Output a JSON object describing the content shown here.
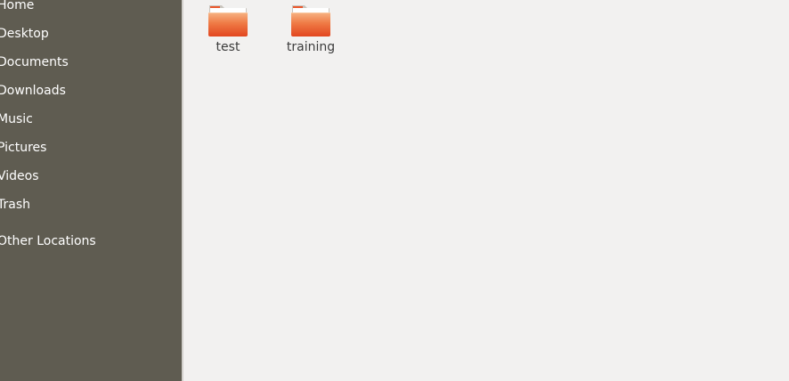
{
  "sidebar": {
    "items": [
      {
        "label": "Home",
        "icon": "home-icon"
      },
      {
        "label": "Desktop",
        "icon": "desktop-icon"
      },
      {
        "label": "Documents",
        "icon": "documents-icon"
      },
      {
        "label": "Downloads",
        "icon": "downloads-icon"
      },
      {
        "label": "Music",
        "icon": "music-icon"
      },
      {
        "label": "Pictures",
        "icon": "pictures-icon"
      },
      {
        "label": "Videos",
        "icon": "videos-icon"
      },
      {
        "label": "Trash",
        "icon": "trash-icon"
      }
    ],
    "other_locations": {
      "label": "Other Locations",
      "icon": "other-locations-icon"
    }
  },
  "files": [
    {
      "name": "test",
      "type": "folder",
      "icon": "folder-icon"
    },
    {
      "name": "training",
      "type": "folder",
      "icon": "folder-icon"
    }
  ],
  "colors": {
    "sidebar_bg": "#5f5c51",
    "sidebar_text": "#ffffff",
    "content_bg": "#f2f1f0",
    "folder_orange": "#e9572b",
    "folder_light": "#f5a36e",
    "file_label": "#3c3c3c"
  }
}
